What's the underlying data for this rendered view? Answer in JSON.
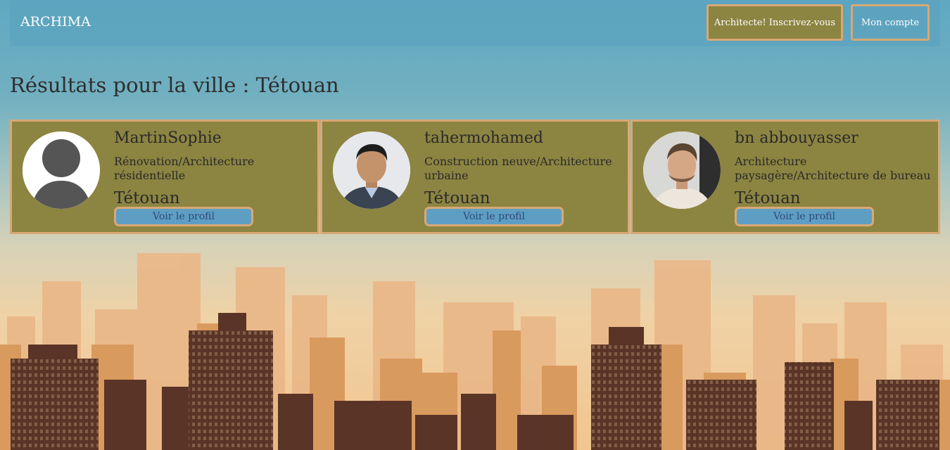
{
  "navbar": {
    "brand": "ARCHIMA",
    "register_label": "Architecte! Inscrivez-vous",
    "account_label": "Mon compte"
  },
  "results": {
    "title": "Résultats pour la ville : Tétouan"
  },
  "architects": [
    {
      "name": "MartinSophie",
      "specialty": "Rénovation/Architecture résidentielle",
      "city": "Tétouan",
      "profile_label": "Voir le profil",
      "avatar_icon": "default-user-icon"
    },
    {
      "name": "tahermohamed",
      "specialty": "Construction neuve/Architecture urbaine",
      "city": "Tétouan",
      "profile_label": "Voir le profil",
      "avatar_icon": "person-photo"
    },
    {
      "name": "bn abbouyasser",
      "specialty": "Architecture paysagère/Architecture de bureau",
      "city": "Tétouan",
      "profile_label": "Voir le profil",
      "avatar_icon": "person-photo"
    }
  ],
  "colors": {
    "card_bg": "#8c8441",
    "border_accent": "#d9a873",
    "button_blue": "#5e9ec3",
    "sky_top": "#5fa8c2",
    "skyline_dark": "#5a3426"
  }
}
